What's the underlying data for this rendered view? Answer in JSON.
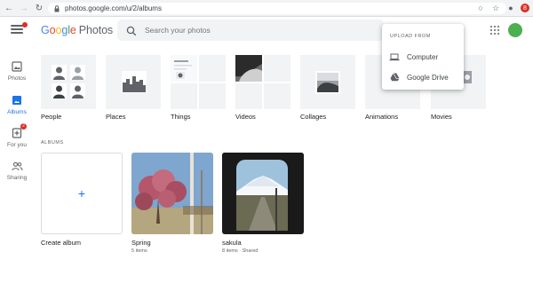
{
  "browser": {
    "url": "photos.google.com/u/2/albums",
    "profile_initial": "8"
  },
  "header": {
    "logo_google": [
      "G",
      "o",
      "o",
      "g",
      "l",
      "e"
    ],
    "logo_product": "Photos",
    "search_placeholder": "Search your photos"
  },
  "upload_menu": {
    "heading": "UPLOAD FROM",
    "items": [
      {
        "label": "Computer",
        "icon": "laptop-icon"
      },
      {
        "label": "Google Drive",
        "icon": "google-drive-icon"
      }
    ]
  },
  "sidebar": {
    "items": [
      {
        "label": "Photos",
        "icon": "photo-icon",
        "active": false
      },
      {
        "label": "Albums",
        "icon": "albums-icon",
        "active": true
      },
      {
        "label": "For you",
        "icon": "for-you-icon",
        "active": false,
        "badge": "2"
      },
      {
        "label": "Sharing",
        "icon": "sharing-icon",
        "active": false
      }
    ]
  },
  "categories": [
    {
      "label": "People"
    },
    {
      "label": "Places"
    },
    {
      "label": "Things"
    },
    {
      "label": "Videos"
    },
    {
      "label": "Collages"
    },
    {
      "label": "Animations"
    },
    {
      "label": "Movies"
    }
  ],
  "albums_section": {
    "heading": "ALBUMS",
    "create_label": "Create album",
    "albums": [
      {
        "title": "Spring",
        "meta": "5 items"
      },
      {
        "title": "sakula",
        "meta": "8 items · Shared"
      }
    ]
  },
  "colors": {
    "accent": "#1a73e8",
    "avatar": "#4caf50",
    "notification": "#d93025"
  }
}
